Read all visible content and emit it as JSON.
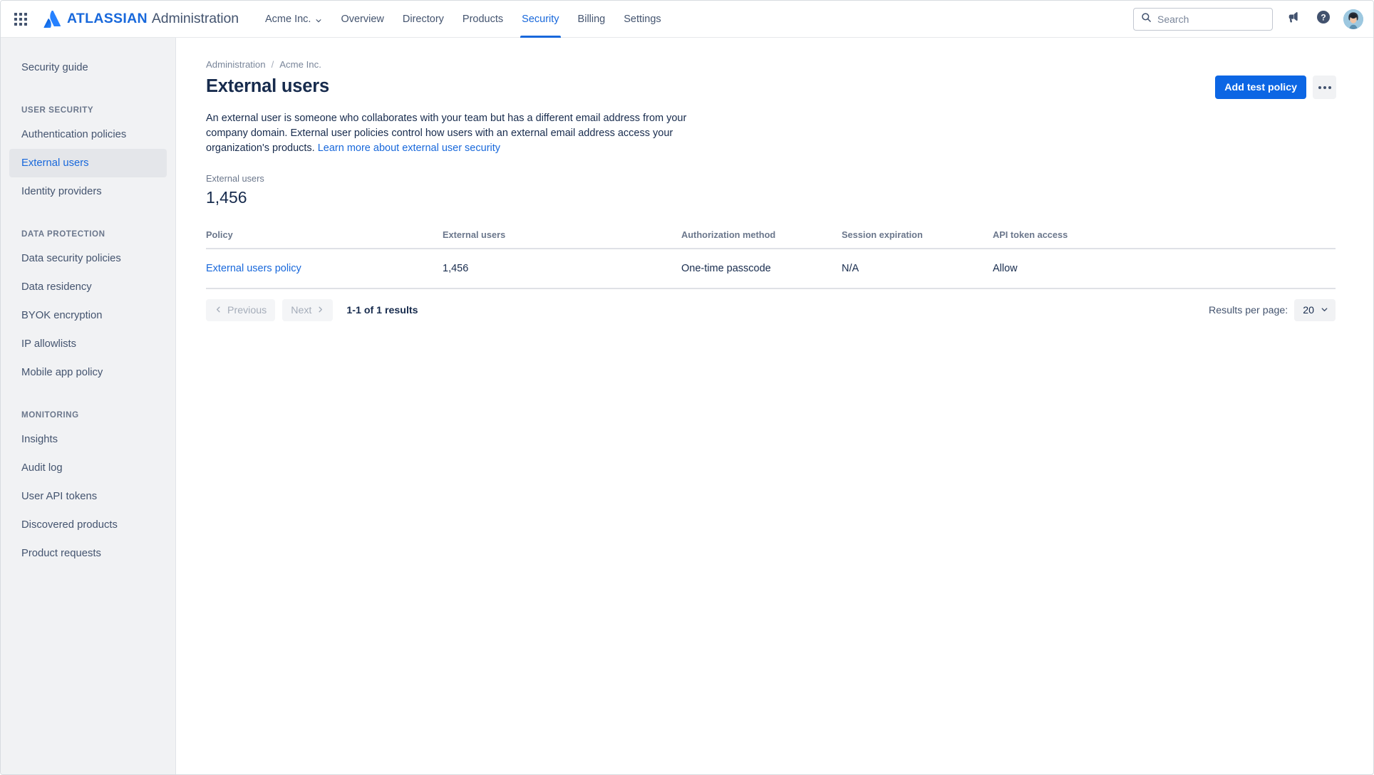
{
  "topnav": {
    "app_switcher_icon": "grid-9-dots-icon",
    "brand_logo_icon": "atlassian-logo-icon",
    "brand_bold": "ATLASSIAN",
    "brand_regular": "Administration",
    "org_selector": "Acme Inc.",
    "org_caret_icon": "chevron-down-icon",
    "items": [
      {
        "label": "Overview",
        "active": false
      },
      {
        "label": "Directory",
        "active": false
      },
      {
        "label": "Products",
        "active": false
      },
      {
        "label": "Security",
        "active": true
      },
      {
        "label": "Billing",
        "active": false
      },
      {
        "label": "Settings",
        "active": false
      }
    ],
    "search": {
      "placeholder": "Search",
      "value": "",
      "icon": "search-icon"
    },
    "notifications_icon": "megaphone-icon",
    "help_icon": "question-circle-icon",
    "avatar_icon": "user-avatar"
  },
  "sidebar": {
    "top_items": [
      {
        "label": "Security guide",
        "selected": false
      }
    ],
    "sections": [
      {
        "heading": "USER SECURITY",
        "items": [
          {
            "label": "Authentication policies",
            "selected": false
          },
          {
            "label": "External users",
            "selected": true
          },
          {
            "label": "Identity providers",
            "selected": false
          }
        ]
      },
      {
        "heading": "DATA PROTECTION",
        "items": [
          {
            "label": "Data security policies",
            "selected": false
          },
          {
            "label": "Data residency",
            "selected": false
          },
          {
            "label": "BYOK encryption",
            "selected": false
          },
          {
            "label": "IP allowlists",
            "selected": false
          },
          {
            "label": "Mobile app policy",
            "selected": false
          }
        ]
      },
      {
        "heading": "MONITORING",
        "items": [
          {
            "label": "Insights",
            "selected": false
          },
          {
            "label": "Audit log",
            "selected": false
          },
          {
            "label": "User API tokens",
            "selected": false
          },
          {
            "label": "Discovered products",
            "selected": false
          },
          {
            "label": "Product requests",
            "selected": false
          }
        ]
      }
    ]
  },
  "main": {
    "breadcrumb": {
      "root": "Administration",
      "separator": "/",
      "current": "Acme Inc."
    },
    "page_title": "External users",
    "actions": {
      "primary_label": "Add test policy",
      "more_icon": "more-horizontal-icon"
    },
    "description": {
      "text": "An external user is someone who collaborates with your team but has a different email address from your company domain. External user policies control how users with an external email address access your organization's products. ",
      "link_text": "Learn more about external user security"
    },
    "stat": {
      "label": "External users",
      "value": "1,456"
    },
    "table": {
      "columns": [
        "Policy",
        "External users",
        "Authorization method",
        "Session expiration",
        "API token access"
      ],
      "rows": [
        {
          "policy": "External users policy",
          "external_users": "1,456",
          "authorization_method": "One-time passcode",
          "session_expiration": "N/A",
          "api_token_access": "Allow"
        }
      ]
    },
    "pagination": {
      "previous_label": "Previous",
      "previous_icon": "chevron-left-icon",
      "next_label": "Next",
      "next_icon": "chevron-right-icon",
      "results_text": "1-1 of 1 results",
      "results_per_page_label": "Results per page:",
      "results_per_page_value": "20",
      "results_per_page_icon": "chevron-down-icon"
    }
  },
  "colors": {
    "brand_blue": "#1868db",
    "primary_button": "#0c66e4",
    "link": "#1868db",
    "sidebar_bg": "#f1f2f4",
    "text_primary": "#172b4d",
    "text_subtle": "#6b778c"
  }
}
